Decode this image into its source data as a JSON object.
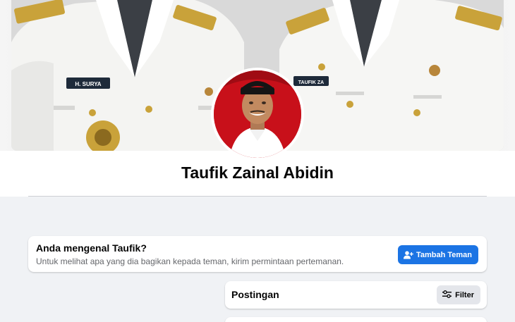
{
  "profile": {
    "name": "Taufik Zainal Abidin",
    "cover_badges": [
      "H. SURYA",
      "TAUFIK ZA"
    ]
  },
  "know_card": {
    "title": "Anda mengenal Taufik?",
    "subtitle": "Untuk melihat apa yang dia bagikan kepada teman, kirim permintaan pertemanan.",
    "button_label": "Tambah Teman",
    "button_icon": "add-friend-icon"
  },
  "posts": {
    "title": "Postingan",
    "filter_label": "Filter",
    "filter_icon": "filter-sliders-icon"
  },
  "colors": {
    "primary_button": "#1b74e4",
    "page_background": "#f0f2f5",
    "secondary_button": "#e4e6eb",
    "avatar_background": "#c8101a"
  }
}
